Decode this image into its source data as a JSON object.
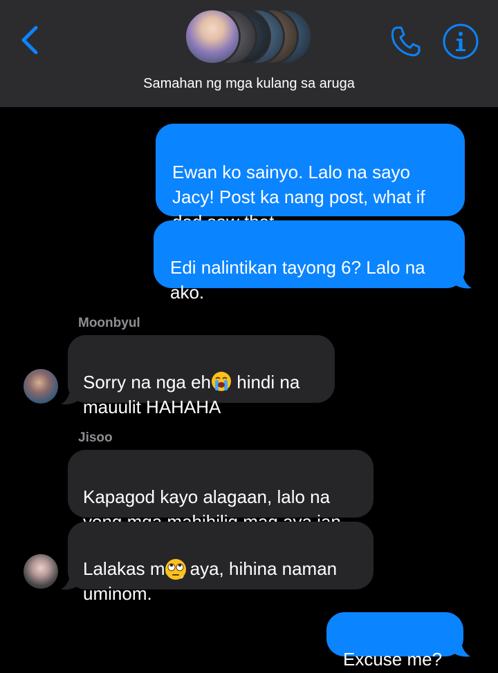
{
  "header": {
    "group_name": "Samahan ng mga kulang sa aruga",
    "back_icon": "chevron-left-icon",
    "call_icon": "phone-icon",
    "info_icon": "info-icon",
    "accent_color": "#0b84ff"
  },
  "messages": [
    {
      "direction": "outgoing",
      "text": "Ewan ko sainyo. Lalo na sayo\nJacy! Post ka nang post, what if\ndad saw that"
    },
    {
      "direction": "outgoing",
      "text": "Edi nalintikan tayong 6? Lalo na\nako."
    },
    {
      "direction": "incoming",
      "sender": "Moonbyul",
      "text_before": "Sorry na nga eh",
      "emoji": "loudly-crying-face-icon",
      "text_after": " hindi na\nmauulit HAHAHA"
    },
    {
      "direction": "incoming",
      "sender": "Jisoo",
      "text": "Kapagod kayo alagaan, lalo na\nyong mga mahihilig mag aya jan"
    },
    {
      "direction": "incoming",
      "text": "Lalakas mag aya, hihina naman\numinom.",
      "emoji": "eye-roll-face-icon"
    },
    {
      "direction": "outgoing",
      "text": "Excuse me?"
    }
  ]
}
